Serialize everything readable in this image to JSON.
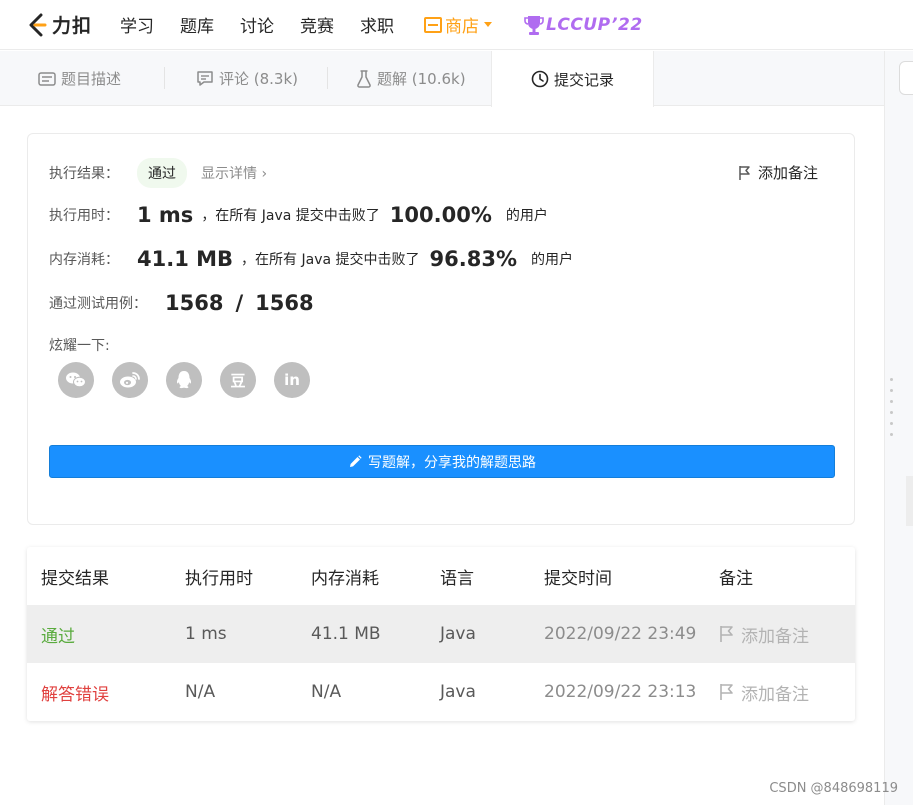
{
  "topnav": {
    "logo_text": "力扣",
    "items": [
      "学习",
      "题库",
      "讨论",
      "竞赛",
      "求职"
    ],
    "store": "商店",
    "event": "LCCUP’22"
  },
  "tabs": [
    {
      "label": "题目描述",
      "icon": "description-icon"
    },
    {
      "label": "评论 (8.3k)",
      "icon": "comment-icon"
    },
    {
      "label": "题解 (10.6k)",
      "icon": "flask-icon"
    },
    {
      "label": "提交记录",
      "icon": "clock-icon",
      "active": true
    }
  ],
  "result": {
    "status_label": "执行结果：",
    "status": "通过",
    "details": "显示详情",
    "add_note": "添加备注",
    "runtime_label": "执行用时：",
    "runtime": "1 ms",
    "runtime_text": "，在所有 Java 提交中击败了",
    "runtime_pct": "100.00%",
    "runtime_suffix": "的用户",
    "memory_label": "内存消耗：",
    "memory": "41.1 MB",
    "memory_text": "，在所有 Java 提交中击败了",
    "memory_pct": "96.83%",
    "memory_suffix": "的用户",
    "tests_label": "通过测试用例：",
    "tests_passed": "1568",
    "tests_sep": "/",
    "tests_total": "1568",
    "share_label": "炫耀一下:",
    "share_icons": [
      "wechat-icon",
      "weibo-icon",
      "qq-icon",
      "douban-icon",
      "linkedin-icon"
    ],
    "share_glyphs": [
      "",
      "",
      "",
      "豆",
      "in"
    ],
    "write_button": "写题解，分享我的解题思路"
  },
  "table": {
    "headers": [
      "提交结果",
      "执行用时",
      "内存消耗",
      "语言",
      "提交时间",
      "备注"
    ],
    "rows": [
      {
        "result": "通过",
        "runtime": "1 ms",
        "memory": "41.1 MB",
        "language": "Java",
        "time": "2022/09/22 23:49",
        "note": "添加备注"
      },
      {
        "result": "解答错误",
        "runtime": "N/A",
        "memory": "N/A",
        "language": "Java",
        "time": "2022/09/22 23:13",
        "note": "添加备注"
      }
    ]
  },
  "watermark": "CSDN @848698119",
  "colors": {
    "accent": "#1a90ff",
    "pass": "#5aab3e",
    "fail": "#e0413f",
    "store": "#ffa116",
    "event": "#b06cf0"
  }
}
